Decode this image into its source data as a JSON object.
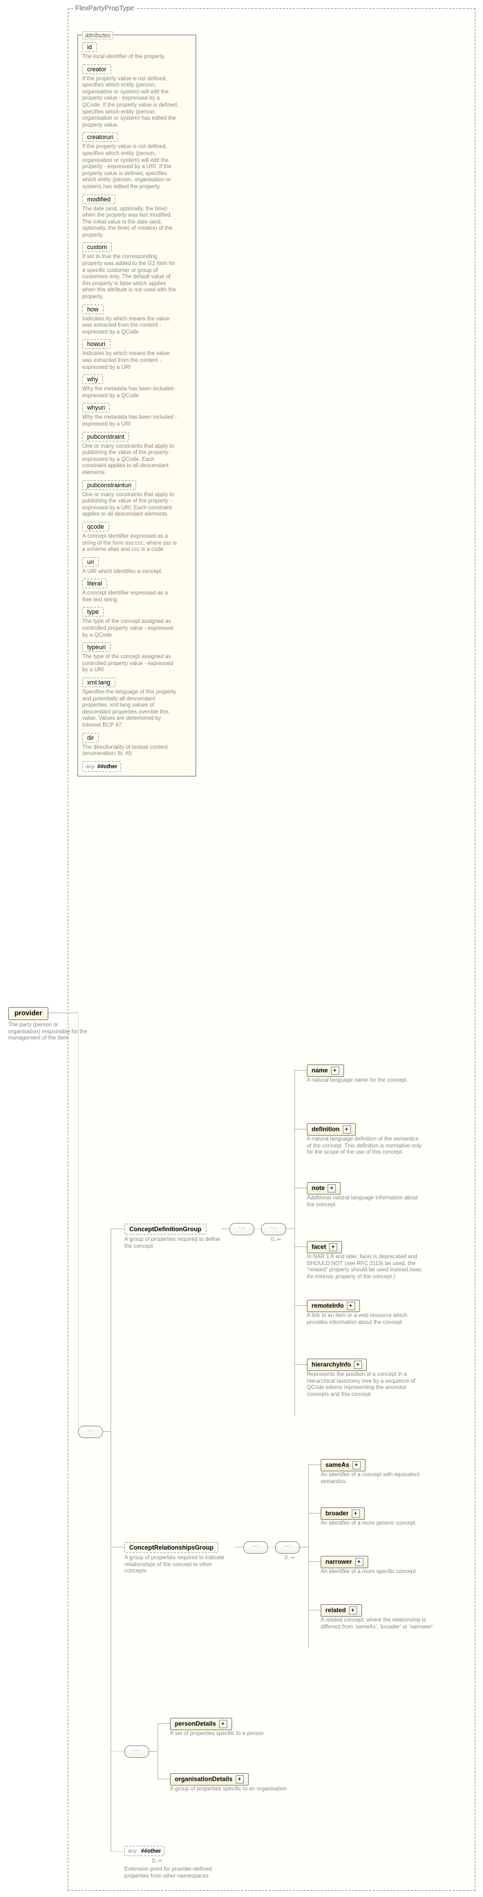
{
  "typeName": "FlexPartyPropType",
  "root": {
    "name": "provider",
    "desc": "The party (person or organisation) responsible for the management of the Item."
  },
  "attributesLabel": "attributes",
  "attributes": [
    {
      "name": "id",
      "desc": "The local identifier of the property."
    },
    {
      "name": "creator",
      "desc": "If the property value is not defined, specifies which entity (person, organisation or system) will edit the property value - expressed by a QCode. If the property value is defined, specifies which entity (person, organisation or system) has edited the property value."
    },
    {
      "name": "creatoruri",
      "desc": "If the property value is not defined, specifies which entity (person, organisation or system) will edit the property - expressed by a URI. If the property value is defined, specifies which entity (person, organisation or system) has edited the property."
    },
    {
      "name": "modified",
      "desc": "The date (and, optionally, the time) when the property was last modified. The initial value is the date (and, optionally, the time) of creation of the property."
    },
    {
      "name": "custom",
      "desc": "If set to true the corresponding property was added to the G2 Item for a specific customer or group of customers only. The default value of this property is false which applies when this attribute is not used with the property."
    },
    {
      "name": "how",
      "desc": "Indicates by which means the value was extracted from the content - expressed by a QCode"
    },
    {
      "name": "howuri",
      "desc": "Indicates by which means the value was extracted from the content - expressed by a URI"
    },
    {
      "name": "why",
      "desc": "Why the metadata has been included - expressed by a QCode"
    },
    {
      "name": "whyuri",
      "desc": "Why the metadata has been included - expressed by a URI"
    },
    {
      "name": "pubconstraint",
      "desc": "One or many constraints that apply to publishing the value of the property - expressed by a QCode. Each constraint applies to all descendant elements."
    },
    {
      "name": "pubconstrainturi",
      "desc": "One or many constraints that apply to publishing the value of the property - expressed by a URI. Each constraint applies to all descendant elements."
    },
    {
      "name": "qcode",
      "desc": "A concept identifier expressed as a string of the form sss:ccc, where sss is a scheme alias and ccc is a code"
    },
    {
      "name": "uri",
      "desc": "A URI which identifies a concept."
    },
    {
      "name": "literal",
      "desc": "A concept identifier expressed as a free text string"
    },
    {
      "name": "type",
      "desc": "The type of the concept assigned as controlled property value - expressed by a QCode"
    },
    {
      "name": "typeuri",
      "desc": "The type of the concept assigned as controlled property value - expressed by a URI"
    },
    {
      "name": "xml:lang",
      "desc": "Specifies the language of this property and potentially all descendant properties. xml:lang values of descendant properties override this value. Values are determined by Internet BCP 47."
    },
    {
      "name": "dir",
      "desc": "The directionality of textual content (enumeration: ltr, rtl)"
    }
  ],
  "anyAttr": {
    "label": "any",
    "value": "##other"
  },
  "groups": {
    "cdg": {
      "name": "ConceptDefinitionGroup",
      "desc": "A group of properties required to define the concept",
      "mult": "0..∞"
    },
    "crg": {
      "name": "ConceptRelationshipsGroup",
      "desc": "A group of properties required to indicate relationships of the concept to other concepts",
      "mult": "0..∞"
    }
  },
  "cdgChildren": [
    {
      "name": "name",
      "desc": "A natural language name for the concept."
    },
    {
      "name": "definition",
      "desc": "A natural language definition of the semantics of the concept. This definition is normative only for the scope of the use of this concept."
    },
    {
      "name": "note",
      "desc": "Additional natural language information about the concept."
    },
    {
      "name": "facet",
      "desc": "In NAR 1.8 and later, facet is deprecated and SHOULD NOT (see RFC 2119) be used, the \"related\" property should be used instead.(was: An intrinsic property of the concept.)"
    },
    {
      "name": "remoteInfo",
      "desc": "A link to an item or a web resource which provides information about the concept"
    },
    {
      "name": "hierarchyInfo",
      "desc": "Represents the position of a concept in a hierarchical taxonomy tree by a sequence of QCode tokens representing the ancestor concepts and this concept"
    }
  ],
  "crgChildren": [
    {
      "name": "sameAs",
      "desc": "An identifier of a concept with equivalent semantics"
    },
    {
      "name": "broader",
      "desc": "An identifier of a more generic concept."
    },
    {
      "name": "narrower",
      "desc": "An identifier of a more specific concept."
    },
    {
      "name": "related",
      "desc": "A related concept, where the relationship is different from 'sameAs', 'broader' or 'narrower'."
    }
  ],
  "choiceChildren": [
    {
      "name": "personDetails",
      "desc": "A set of properties specific to a person"
    },
    {
      "name": "organisationDetails",
      "desc": "A group of properties specific to an organisation"
    }
  ],
  "anyEl": {
    "label": "any",
    "value": "##other",
    "mult": "0..∞",
    "desc": "Extension point for provider-defined properties from other namespaces"
  }
}
